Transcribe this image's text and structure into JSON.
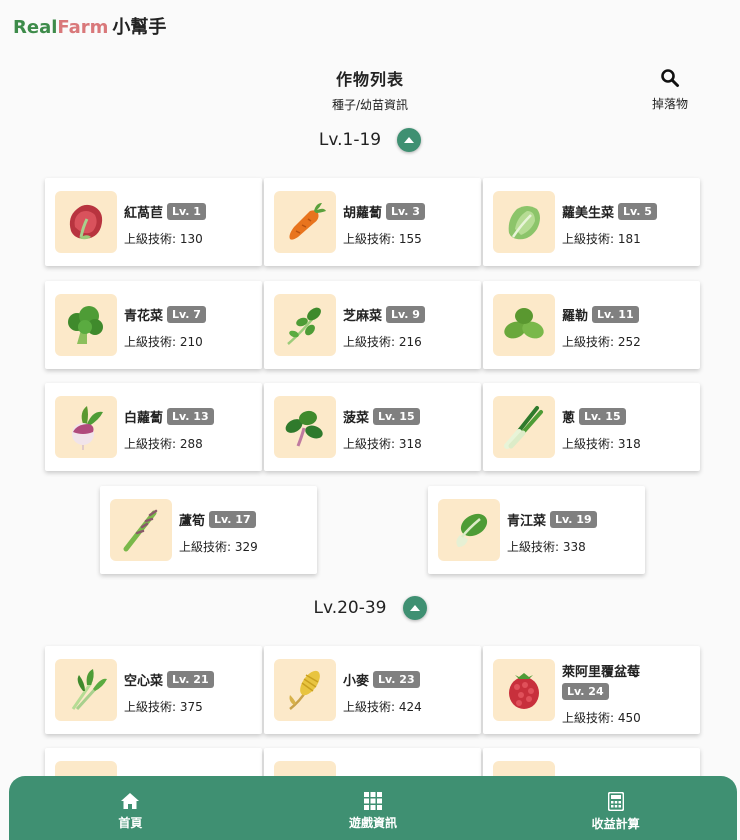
{
  "brand": {
    "part1": "Real",
    "part2": "Farm",
    "part3": "小幫手"
  },
  "header": {
    "title": "作物列表",
    "subtitle": "種子/幼苗資訊",
    "drops_label": "掉落物"
  },
  "stat_label": "上級技術: ",
  "sections": [
    {
      "title": "Lv.1-19",
      "crops": [
        {
          "name": "紅萵苣",
          "level": "Lv. 1",
          "skill": "130",
          "icon": "red-lettuce-icon"
        },
        {
          "name": "胡蘿蔔",
          "level": "Lv. 3",
          "skill": "155",
          "icon": "carrot-icon"
        },
        {
          "name": "蘿美生菜",
          "level": "Lv. 5",
          "skill": "181",
          "icon": "romaine-lettuce-icon"
        },
        {
          "name": "青花菜",
          "level": "Lv. 7",
          "skill": "210",
          "icon": "broccoli-icon"
        },
        {
          "name": "芝麻菜",
          "level": "Lv. 9",
          "skill": "216",
          "icon": "arugula-icon"
        },
        {
          "name": "羅勒",
          "level": "Lv. 11",
          "skill": "252",
          "icon": "basil-icon"
        },
        {
          "name": "白蘿蔔",
          "level": "Lv. 13",
          "skill": "288",
          "icon": "turnip-icon"
        },
        {
          "name": "菠菜",
          "level": "Lv. 15",
          "skill": "318",
          "icon": "spinach-icon"
        },
        {
          "name": "蔥",
          "level": "Lv. 15",
          "skill": "318",
          "icon": "green-onion-icon"
        },
        {
          "name": "蘆筍",
          "level": "Lv. 17",
          "skill": "329",
          "icon": "asparagus-icon"
        },
        {
          "name": "青江菜",
          "level": "Lv. 19",
          "skill": "338",
          "icon": "bok-choy-icon"
        }
      ]
    },
    {
      "title": "Lv.20-39",
      "crops": [
        {
          "name": "空心菜",
          "level": "Lv. 21",
          "skill": "375",
          "icon": "water-spinach-icon"
        },
        {
          "name": "小麥",
          "level": "Lv. 23",
          "skill": "424",
          "icon": "wheat-icon"
        },
        {
          "name": "萊阿里覆盆莓",
          "level": "Lv. 24",
          "skill": "450",
          "icon": "raspberry-icon"
        }
      ]
    }
  ],
  "nav": [
    {
      "label": "首頁",
      "icon": "home-icon"
    },
    {
      "label": "遊戲資訊",
      "icon": "grid-icon"
    },
    {
      "label": "收益計算",
      "icon": "calculator-icon"
    }
  ],
  "colors": {
    "accent": "#3f9072",
    "badge": "#808080",
    "thumb_bg": "#fce9c9"
  }
}
